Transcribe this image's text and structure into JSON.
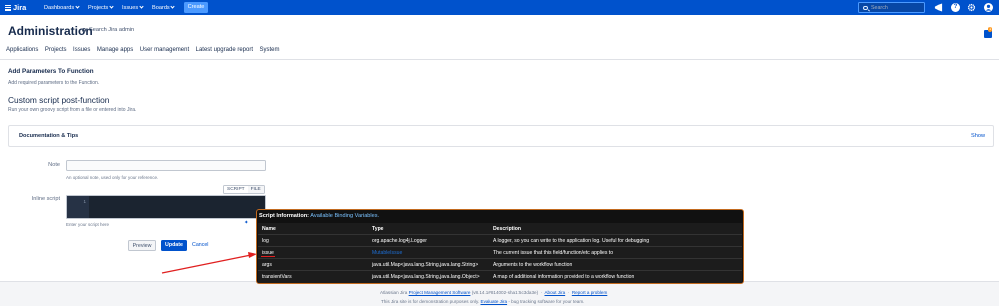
{
  "topnav": {
    "logo_text": "Jira",
    "items": [
      {
        "label": "Dashboards"
      },
      {
        "label": "Projects"
      },
      {
        "label": "Issues"
      },
      {
        "label": "Boards"
      }
    ],
    "create_label": "Create",
    "search_placeholder": "Search",
    "help_glyph": "?",
    "brand_color": "#0052cc"
  },
  "admin": {
    "title": "Administration",
    "search_label": "Search Jira admin",
    "notification_count": "1",
    "tabs": [
      {
        "label": "Applications"
      },
      {
        "label": "Projects"
      },
      {
        "label": "Issues"
      },
      {
        "label": "Manage apps"
      },
      {
        "label": "User management"
      },
      {
        "label": "Latest upgrade report"
      },
      {
        "label": "System"
      }
    ]
  },
  "form": {
    "heading": "Add Parameters To Function",
    "heading_sub": "Add required parameters to the Function.",
    "section_title": "Custom script post-function",
    "section_sub": "Run your own groovy script from a file or entered into Jira.",
    "doc_title": "Documentation & Tips",
    "doc_show": "Show",
    "note_label": "Note",
    "note_help": "An optional note, used only for your reference.",
    "script_label": "Inline script",
    "toggle": [
      "SCRIPT",
      "FILE"
    ],
    "line_number": "1",
    "script_help": "Enter your script here",
    "preview_label": "Preview",
    "update_label": "Update",
    "cancel_label": "Cancel"
  },
  "popup": {
    "title": "Script Information:",
    "subtitle": "Available Binding Variables.",
    "columns": [
      "Name",
      "Type",
      "Description"
    ],
    "rows": [
      {
        "name": "log",
        "type": "org.apache.log4j.Logger",
        "desc": "A logger, so you can write to the application log. Useful for debugging"
      },
      {
        "name": "issue",
        "type": "MutableIssue",
        "desc": "The current issue that this field/function/etc applies to"
      },
      {
        "name": "args",
        "type": "java.util.Map<java.lang.String,java.lang.String>",
        "desc": "Arguments to the workflow function"
      },
      {
        "name": "transientVars",
        "type": "java.util.Map<java.lang.String,java.lang.Object>",
        "desc": "A map of additional information provided to a workflow function"
      }
    ],
    "border_color": "#c26a1f"
  },
  "footer": {
    "line1_prefix": "Atlassian Jira",
    "line1_link": "Project Management Software",
    "line1_version": "(v8.14.1#814002-sha1:5c3da3e)",
    "about": "About Jira",
    "report": "Report a problem",
    "line2_prefix": "This Jira site is for demonstration purposes only.",
    "line2_link": "Evaluate Jira",
    "line2_suffix": "- bug tracking software for your team."
  },
  "annotation_color": "#e02020"
}
